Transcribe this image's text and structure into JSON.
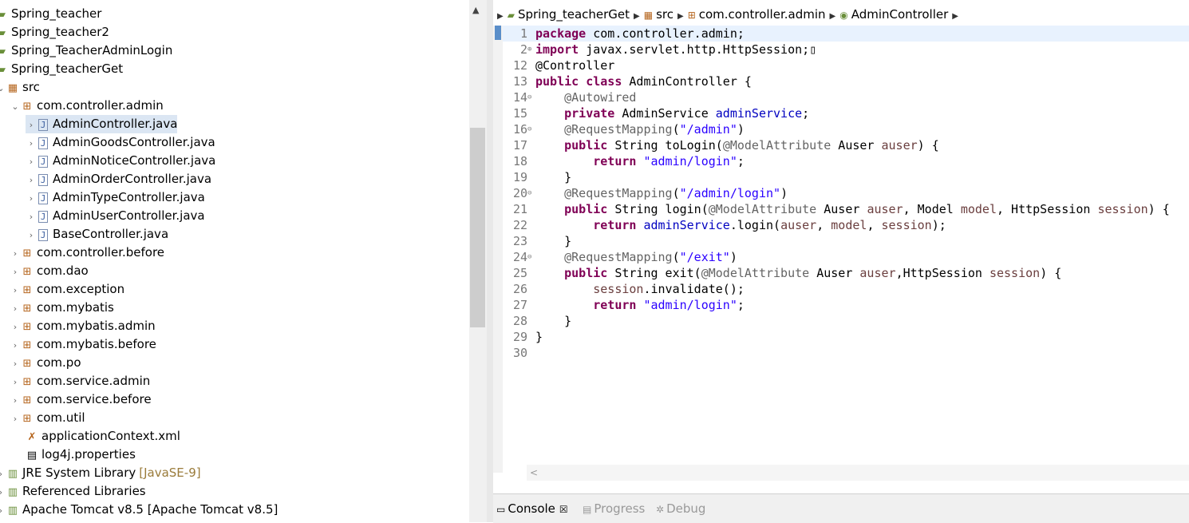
{
  "explorer": {
    "projects": [
      {
        "label": "Spring_teacher"
      },
      {
        "label": "Spring_teacher2"
      },
      {
        "label": "Spring_TeacherAdminLogin"
      },
      {
        "label": "Spring_teacherGet"
      }
    ],
    "src_label": "src",
    "packages": [
      {
        "label": "com.controller.admin",
        "expanded": true
      },
      {
        "label": "com.controller.before"
      },
      {
        "label": "com.dao"
      },
      {
        "label": "com.exception"
      },
      {
        "label": "com.mybatis"
      },
      {
        "label": "com.mybatis.admin"
      },
      {
        "label": "com.mybatis.before"
      },
      {
        "label": "com.po"
      },
      {
        "label": "com.service.admin"
      },
      {
        "label": "com.service.before"
      },
      {
        "label": "com.util"
      }
    ],
    "files": [
      {
        "label": "AdminController.java",
        "selected": true
      },
      {
        "label": "AdminGoodsController.java"
      },
      {
        "label": "AdminNoticeController.java"
      },
      {
        "label": "AdminOrderController.java"
      },
      {
        "label": "AdminTypeController.java"
      },
      {
        "label": "AdminUserController.java"
      },
      {
        "label": "BaseController.java"
      }
    ],
    "resources": [
      {
        "label": "applicationContext.xml"
      },
      {
        "label": "log4j.properties"
      }
    ],
    "libraries": [
      {
        "label": "JRE System Library",
        "decoration": "[JavaSE-9]"
      },
      {
        "label": "Referenced Libraries",
        "decoration": ""
      },
      {
        "label": "Apache Tomcat v8.5 [Apache Tomcat v8.5]",
        "decoration": ""
      }
    ]
  },
  "breadcrumb": [
    "Spring_teacherGet",
    "src",
    "com.controller.admin",
    "AdminController"
  ],
  "code": [
    {
      "n": "1",
      "fold": "",
      "html": "<span class=\"kw\">package</span> com.controller.admin;",
      "current": true
    },
    {
      "n": "2",
      "fold": "⊕",
      "html": "<span class=\"kw\">import</span> javax.servlet.http.HttpSession;▯"
    },
    {
      "n": "12",
      "fold": "",
      "html": "@Controller"
    },
    {
      "n": "13",
      "fold": "",
      "html": "<span class=\"kw\">public</span> <span class=\"kw\">class</span> AdminController {"
    },
    {
      "n": "14",
      "fold": "⊖",
      "html": "    <span class=\"ann\">@Autowired</span>"
    },
    {
      "n": "15",
      "fold": "",
      "html": "    <span class=\"kw\">private</span> AdminService <span class=\"field\">adminService</span>;"
    },
    {
      "n": "16",
      "fold": "⊖",
      "html": "    <span class=\"ann\">@RequestMapping</span>(<span class=\"str\">\"/admin\"</span>)"
    },
    {
      "n": "17",
      "fold": "",
      "html": "    <span class=\"kw\">public</span> String toLogin(<span class=\"ann\">@ModelAttribute</span> Auser <span class=\"param\">auser</span>) {"
    },
    {
      "n": "18",
      "fold": "",
      "html": "        <span class=\"kw\">return</span> <span class=\"str\">\"admin/login\"</span>;"
    },
    {
      "n": "19",
      "fold": "",
      "html": "    }"
    },
    {
      "n": "20",
      "fold": "⊖",
      "html": "    <span class=\"ann\">@RequestMapping</span>(<span class=\"str\">\"/admin/login\"</span>)"
    },
    {
      "n": "21",
      "fold": "",
      "html": "    <span class=\"kw\">public</span> String login(<span class=\"ann\">@ModelAttribute</span> Auser <span class=\"param\">auser</span>, Model <span class=\"param\">model</span>, HttpSession <span class=\"param\">session</span>) {"
    },
    {
      "n": "22",
      "fold": "",
      "html": "        <span class=\"kw\">return</span> <span class=\"field\">adminService</span>.login(<span class=\"param\">auser</span>, <span class=\"param\">model</span>, <span class=\"param\">session</span>);"
    },
    {
      "n": "23",
      "fold": "",
      "html": "    }"
    },
    {
      "n": "24",
      "fold": "⊖",
      "html": "    <span class=\"ann\">@RequestMapping</span>(<span class=\"str\">\"/exit\"</span>)"
    },
    {
      "n": "25",
      "fold": "",
      "html": "    <span class=\"kw\">public</span> String exit(<span class=\"ann\">@ModelAttribute</span> Auser <span class=\"param\">auser</span>,HttpSession <span class=\"param\">session</span>) {"
    },
    {
      "n": "26",
      "fold": "",
      "html": "        <span class=\"param\">session</span>.invalidate();"
    },
    {
      "n": "27",
      "fold": "",
      "html": "        <span class=\"kw\">return</span> <span class=\"str\">\"admin/login\"</span>;"
    },
    {
      "n": "28",
      "fold": "",
      "html": "    }"
    },
    {
      "n": "29",
      "fold": "",
      "html": "}"
    },
    {
      "n": "30",
      "fold": "",
      "html": ""
    }
  ],
  "bottom_tabs": [
    {
      "label": "Console",
      "active": true,
      "close": "☒",
      "icon": "console-icon"
    },
    {
      "label": "Progress",
      "active": false,
      "icon": "progress-icon"
    },
    {
      "label": "Debug",
      "active": false,
      "icon": "debug-icon"
    }
  ]
}
